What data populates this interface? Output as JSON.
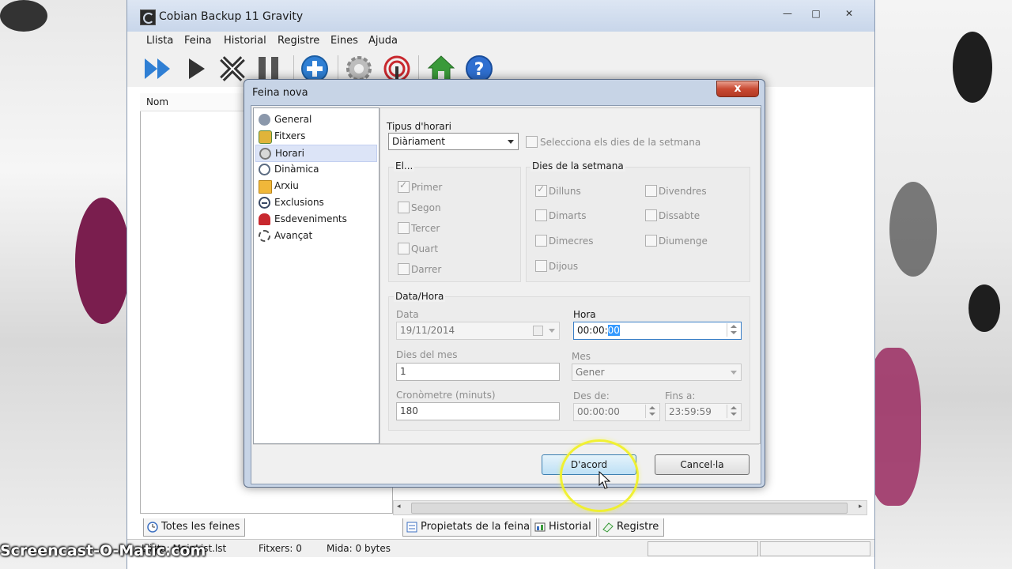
{
  "window": {
    "title": "Cobian Backup 11 Gravity",
    "controls": {
      "minimize": "—",
      "maximize": "□",
      "close": "✕"
    }
  },
  "menu": [
    "Llista",
    "Feina",
    "Historial",
    "Registre",
    "Eines",
    "Ajuda"
  ],
  "toolbar": [
    {
      "name": "run-all-icon"
    },
    {
      "name": "play-icon"
    },
    {
      "name": "stop-icon"
    },
    {
      "name": "pause-icon"
    },
    {
      "name": "add-task-icon"
    },
    {
      "name": "settings-gear-icon"
    },
    {
      "name": "network-icon"
    },
    {
      "name": "home-icon"
    },
    {
      "name": "help-icon"
    }
  ],
  "list": {
    "column_nom": "Nom"
  },
  "bottom_tabs_left": [
    "Totes les feines"
  ],
  "bottom_tabs_right": [
    "Propietats de la feina",
    "Historial",
    "Registre"
  ],
  "statusbar": {
    "list": "Llista: MainList.lst",
    "files": "Fitxers: 0",
    "size": "Mida: 0 bytes"
  },
  "watermark": "Screencast-O-Matic.com",
  "dialog": {
    "title": "Feina nova",
    "close": "x",
    "nav": [
      {
        "label": "General",
        "icon": "user-icon",
        "color": "#7a8aa0"
      },
      {
        "label": "Fitxers",
        "icon": "files-icon",
        "color": "#e0b43a"
      },
      {
        "label": "Horari",
        "icon": "clock-icon",
        "color": "#909090",
        "selected": true
      },
      {
        "label": "Dinàmica",
        "icon": "dynamic-icon",
        "color": "#5a6a80"
      },
      {
        "label": "Arxiu",
        "icon": "folder-icon",
        "color": "#e8b13a"
      },
      {
        "label": "Exclusions",
        "icon": "exclusion-icon",
        "color": "#3b4a66"
      },
      {
        "label": "Esdeveniments",
        "icon": "magnet-icon",
        "color": "#c8282e"
      },
      {
        "label": "Avançat",
        "icon": "advanced-gear-icon",
        "color": "#505050"
      }
    ],
    "schedule": {
      "type_label": "Tipus d'horari",
      "type_value": "Diàriament",
      "select_days_label": "Selecciona els dies de la setmana",
      "el_label": "El...",
      "el_options": [
        {
          "label": "Primer",
          "checked": true
        },
        {
          "label": "Segon",
          "checked": false
        },
        {
          "label": "Tercer",
          "checked": false
        },
        {
          "label": "Quart",
          "checked": false
        },
        {
          "label": "Darrer",
          "checked": false
        }
      ],
      "weekdays_label": "Dies de la setmana",
      "weekdays": [
        {
          "label": "Dilluns",
          "checked": true
        },
        {
          "label": "Dimarts",
          "checked": false
        },
        {
          "label": "Dimecres",
          "checked": false
        },
        {
          "label": "Dijous",
          "checked": false
        },
        {
          "label": "Divendres",
          "checked": false
        },
        {
          "label": "Dissabte",
          "checked": false
        },
        {
          "label": "Diumenge",
          "checked": false
        }
      ],
      "datetime_label": "Data/Hora",
      "date_label": "Data",
      "date_value": "19/11/2014",
      "hour_label": "Hora",
      "hour_value_prefix": "00:00:",
      "hour_value_selected": "00",
      "month_days_label": "Dies del mes",
      "month_days_value": "1",
      "month_label": "Mes",
      "month_value": "Gener",
      "timer_label": "Cronòmetre (minuts)",
      "timer_value": "180",
      "from_label": "Des de:",
      "from_value": "00:00:00",
      "to_label": "Fins a:",
      "to_value": "23:59:59"
    },
    "ok_label": "D'acord",
    "cancel_label": "Cancel·la"
  },
  "colors": {
    "selection": "#dce4f7",
    "dialog_frame": "#c7d4e6",
    "close_red": "#c94a33",
    "highlight_ring": "#f0f028"
  }
}
